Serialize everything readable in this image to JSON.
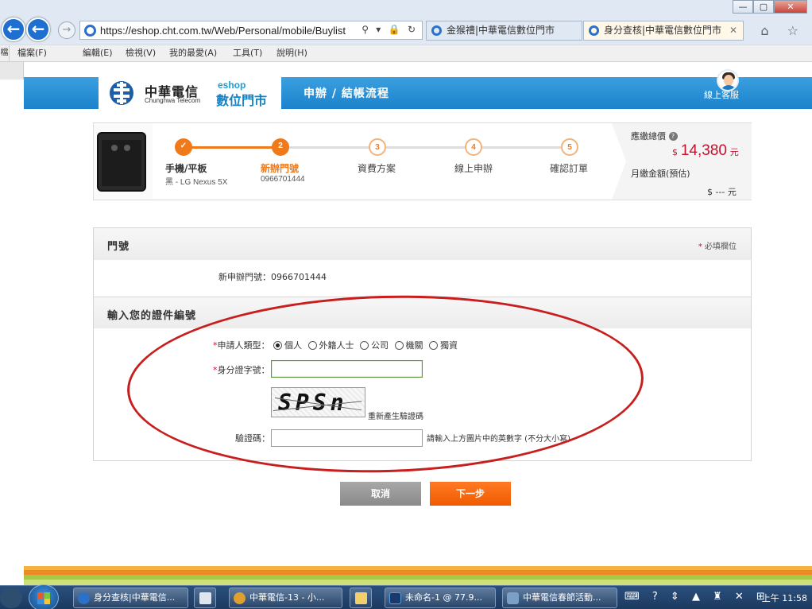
{
  "browser": {
    "url": "https://eshop.cht.com.tw/Web/Personal/mobile/Buylist",
    "tabs": [
      {
        "label": "金猴禮|中華電信數位門市",
        "active": false
      },
      {
        "label": "身分查核|中華電信數位門市",
        "active": true
      }
    ],
    "address_tools": "⚲ ▾ 🔒 ↻",
    "menu": [
      "檔案(F)",
      "編輯(E)",
      "檢視(V)",
      "我的最愛(A)",
      "工具(T)",
      "說明(H)"
    ],
    "menu_grip": "檔",
    "window_controls": [
      "—",
      "▢",
      "✕"
    ],
    "right_icons": "⌂ ☆"
  },
  "site": {
    "logo_cn": "中華電信",
    "logo_en": "Chunghwa Telecom",
    "eshop_en": "eshop",
    "eshop_cn": "數位門市",
    "header_title": "申辦 / 結帳流程",
    "support_label": "線上客服"
  },
  "progress": {
    "product_type": "手機/平板",
    "product_model": "黑 - LG Nexus 5X",
    "steps": [
      {
        "num": "✓",
        "label": "手機/平板",
        "state": "done"
      },
      {
        "num": "2",
        "label": "新辦門號",
        "sub": "0966701444",
        "state": "current"
      },
      {
        "num": "3",
        "label": "資費方案",
        "state": "todo"
      },
      {
        "num": "4",
        "label": "線上申辦",
        "state": "todo"
      },
      {
        "num": "5",
        "label": "確認訂單",
        "state": "todo"
      }
    ],
    "total_label": "應繳總價",
    "total_currency": "$",
    "total_amount": "14,380",
    "total_unit": "元",
    "monthly_label": "月繳金額(預估)",
    "monthly_value": "$ --- 元",
    "help_glyph": "?",
    "colors": {
      "accent": "#f07a1a",
      "track_done": "#f07a1a",
      "track_todo": "#dddddd",
      "price": "#c8102e"
    }
  },
  "form": {
    "section1_title": "門號",
    "required_mark": "*",
    "required_note": "必填欄位",
    "new_number_label": "新申辦門號：",
    "new_number_value": "0966701444",
    "section2_title": "輸入您的證件編號",
    "applicant_type_label": "申請人類型：",
    "applicant_types": [
      {
        "label": "個人",
        "selected": true
      },
      {
        "label": "外籍人士",
        "selected": false
      },
      {
        "label": "公司",
        "selected": false
      },
      {
        "label": "機關",
        "selected": false
      },
      {
        "label": "獨資",
        "selected": false
      }
    ],
    "id_label": "身分證字號：",
    "id_value": "",
    "captcha_text": "SPSn",
    "regen_label": "重新產生驗證碼",
    "captcha_label": "驗證碼：",
    "captcha_value": "",
    "captcha_hint": "請輸入上方圖片中的英數字 (不分大小寫)"
  },
  "buttons": {
    "cancel": "取消",
    "next": "下一步"
  },
  "taskbar": {
    "tasks": [
      {
        "label": "身分查核|中華電信...",
        "icon_color": "#2b70c9"
      },
      {
        "label": "中華電信-13 - 小...",
        "icon_color": "#e0a030"
      },
      {
        "label": "未命名-1 @ 77.9...",
        "icon_color": "#1b3a6b"
      },
      {
        "label": "中華電信春節活動...",
        "icon_color": "#7aa0c8"
      }
    ],
    "tray_icons": "⌨ ? ⇕ ▲ ♜ ✕ ⊞",
    "clock": "上午 11:58"
  }
}
